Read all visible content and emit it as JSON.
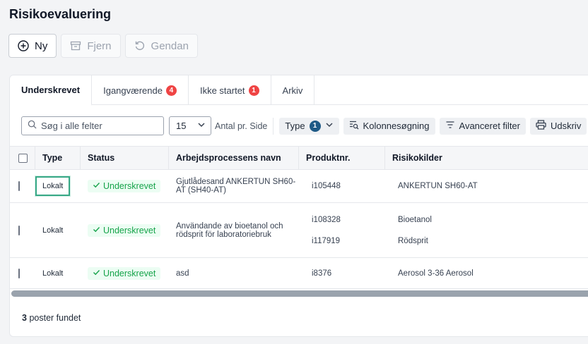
{
  "page": {
    "title": "Risikoevaluering"
  },
  "toolbar": {
    "new_label": "Ny",
    "remove_label": "Fjern",
    "restore_label": "Gendan"
  },
  "tabs": [
    {
      "label": "Underskrevet",
      "badge": ""
    },
    {
      "label": "Igangværende",
      "badge": "4"
    },
    {
      "label": "Ikke startet",
      "badge": "1"
    },
    {
      "label": "Arkiv",
      "badge": ""
    }
  ],
  "filters": {
    "search_placeholder": "Søg i alle felter",
    "page_size": "15",
    "per_page_label": "Antal pr. Side",
    "type_label": "Type",
    "type_count": "1",
    "column_search_label": "Kolonnesøgning",
    "advanced_filter_label": "Avanceret filter",
    "print_label": "Udskriv"
  },
  "table": {
    "headers": {
      "type": "Type",
      "status": "Status",
      "name": "Arbejdsprocessens navn",
      "product": "Produktnr.",
      "risk": "Risikokilder"
    },
    "rows": [
      {
        "type": "Lokalt",
        "status": "Underskrevet",
        "name": "Gjutlådesand ANKERTUN SH60-AT (SH40-AT)",
        "products": [
          "i105448"
        ],
        "risks": [
          "ANKERTUN SH60-AT"
        ]
      },
      {
        "type": "Lokalt",
        "status": "Underskrevet",
        "name": "Användande av bioetanol och rödsprit för laboratoriebruk",
        "products": [
          "i108328",
          "i117919"
        ],
        "risks": [
          "Bioetanol",
          "Rödsprit"
        ]
      },
      {
        "type": "Lokalt",
        "status": "Underskrevet",
        "name": "asd",
        "products": [
          "i8376"
        ],
        "risks": [
          "Aerosol 3-36 Aerosol"
        ]
      }
    ]
  },
  "footer": {
    "count": "3",
    "label": "poster fundet"
  },
  "colors": {
    "success": "#16a34a",
    "danger_badge": "#ef4444",
    "info_badge": "#1e5a86",
    "highlight": "#38a886"
  }
}
